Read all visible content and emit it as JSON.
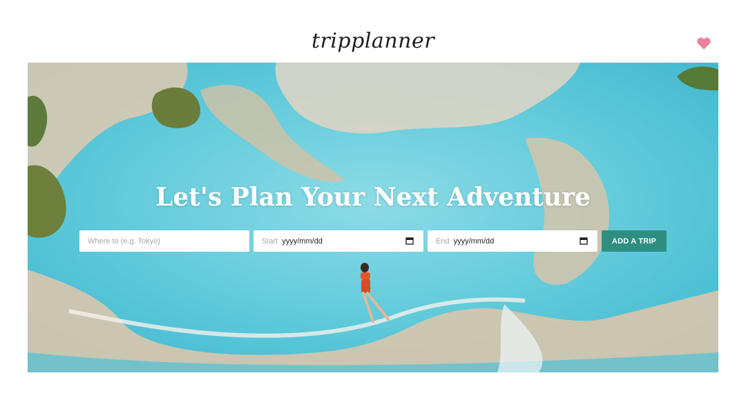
{
  "header": {
    "logo_text": "tripplanner",
    "favorites_icon": "heart-icon",
    "favorites_color": "#e8839a"
  },
  "hero": {
    "headline": "Let's Plan Your Next Adventure",
    "background_image": "aerial-turquoise-thermal-pools"
  },
  "trip_form": {
    "destination": {
      "placeholder": "Where to (e.g. Tokyo)",
      "value": ""
    },
    "start": {
      "prefix": "Start",
      "value": "yyyy/mm/dd",
      "icon": "calendar-icon"
    },
    "end": {
      "prefix": "End",
      "value": "yyyy/mm/dd",
      "icon": "calendar-icon"
    },
    "submit_label": "ADD A TRIP"
  },
  "colors": {
    "accent": "#2e8f81",
    "water": "#56c6d8",
    "rock": "#d8c6ad"
  }
}
